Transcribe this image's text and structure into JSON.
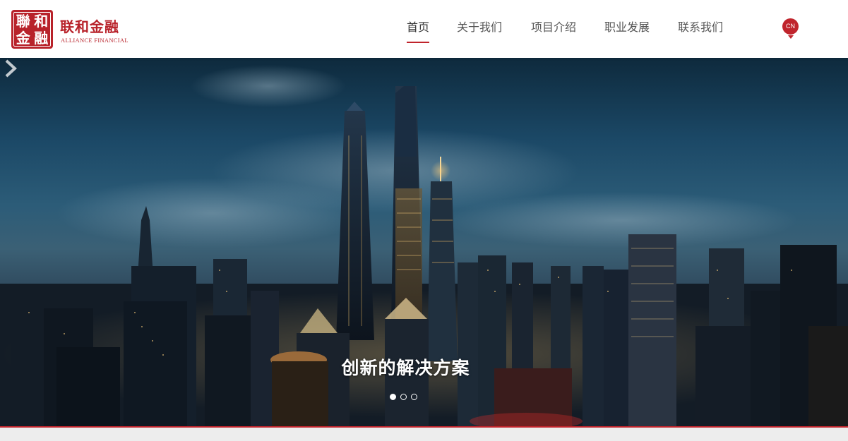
{
  "brand": {
    "seal_chars": [
      "金",
      "聯",
      "融",
      "和"
    ],
    "name_cn": "联和金融",
    "name_en": "ALLIANCE FINANCIAL",
    "color": "#b8222a"
  },
  "nav": {
    "items": [
      {
        "label": "首页",
        "active": true
      },
      {
        "label": "关于我们",
        "active": false
      },
      {
        "label": "项目介绍",
        "active": false
      },
      {
        "label": "职业发展",
        "active": false
      },
      {
        "label": "联系我们",
        "active": false
      }
    ],
    "language": "CN",
    "accent": "#c0242c"
  },
  "hero": {
    "caption": "创新的解决方案",
    "slide_count": 3,
    "active_slide": 1,
    "next_icon": "chevron-right-icon"
  }
}
